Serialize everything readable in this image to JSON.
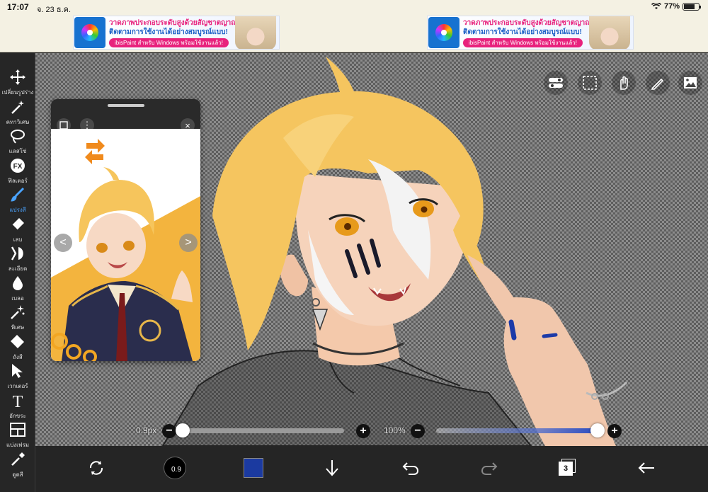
{
  "status_bar": {
    "time": "17:07",
    "date": "จ. 23 ธ.ค.",
    "battery": "77%",
    "battery_level": 0.77
  },
  "ads": [
    {
      "line1": "วาดภาพประกอบระดับสูงด้วยสัญชาตญาณ!",
      "line2": "ติดตามการใช้งานได้อย่างสมบูรณ์แบบ!",
      "line3": "ibisPaint สำหรับ Windows พร้อมใช้งานแล้ว!"
    },
    {
      "line1": "วาดภาพประกอบระดับสูงด้วยสัญชาตญาณ!",
      "line2": "ติดตามการใช้งานได้อย่างสมบูรณ์แบบ!",
      "line3": "ibisPaint สำหรับ Windows พร้อมใช้งานแล้ว!"
    }
  ],
  "left_toolbar": {
    "tools": [
      {
        "label": "เปลี่ยนรูปร่าง",
        "icon": "move-icon",
        "active": false
      },
      {
        "label": "คทาวิเศษ",
        "icon": "magic-wand-icon",
        "active": false
      },
      {
        "label": "แลสโซ่",
        "icon": "lasso-icon",
        "active": false
      },
      {
        "label": "ฟิลเตอร์",
        "icon": "fx-filter-icon",
        "active": false
      },
      {
        "label": "แปรงสี",
        "icon": "brush-icon",
        "active": true
      },
      {
        "label": "เลบ",
        "icon": "eraser-icon",
        "active": false
      },
      {
        "label": "ละเอียด",
        "icon": "smudge-icon",
        "active": false
      },
      {
        "label": "เบลอ",
        "icon": "blur-drop-icon",
        "active": false
      },
      {
        "label": "พิเศษ",
        "icon": "special-sparkle-icon",
        "active": false
      },
      {
        "label": "ถังสี",
        "icon": "fill-bucket-icon",
        "active": false
      },
      {
        "label": "เวกเตอร์",
        "icon": "vector-cursor-icon",
        "active": false
      },
      {
        "label": "อักขระ",
        "icon": "text-icon",
        "active": false
      },
      {
        "label": "แบ่งเฟรม",
        "icon": "frame-divider-icon",
        "active": false
      },
      {
        "label": "ดูดสี",
        "icon": "eyedropper-icon",
        "active": false
      }
    ]
  },
  "canvas_controls": {
    "icons": [
      "toggle-settings-icon",
      "selection-rect-icon",
      "hand-touch-icon",
      "ruler-pen-icon",
      "reference-image-icon"
    ]
  },
  "reference_window": {
    "arrow_left": "<",
    "arrow_right": ">",
    "more": "⋮",
    "close": "×"
  },
  "brush_size": {
    "label": "0.9px",
    "minus": "−",
    "plus": "+",
    "value": 0.9,
    "fraction": 0.0
  },
  "opacity": {
    "label": "100%",
    "minus": "−",
    "plus": "+",
    "value": 100,
    "fraction": 1.0
  },
  "bottom_toolbar": {
    "brush_size_text": "0.9",
    "layer_count": "3",
    "primary_color": "#1b3aa0",
    "icons": [
      "rotate-transform-icon",
      "brush-size-circle",
      "color-swatch",
      "down-arrow-icon",
      "undo-icon",
      "redo-icon",
      "layers-icon",
      "back-arrow-icon"
    ]
  }
}
